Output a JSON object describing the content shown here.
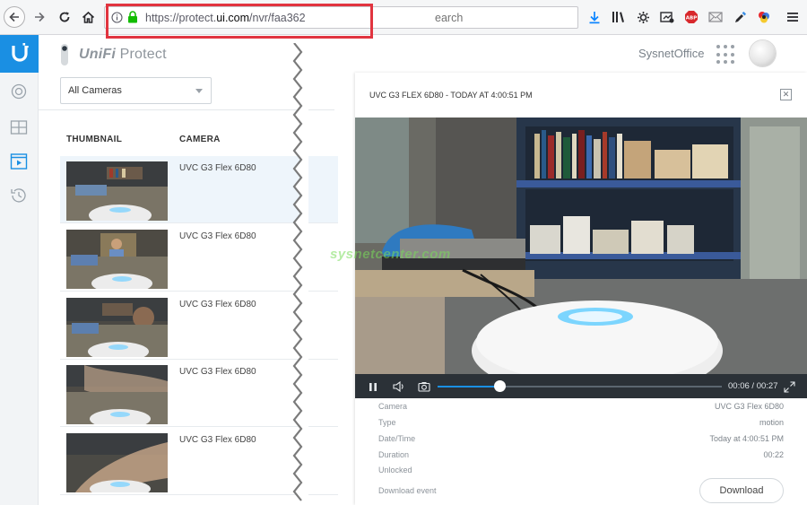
{
  "browser": {
    "url_prefix": "https://protect.",
    "url_host": "ui.com",
    "url_path": "/nvr/faa362",
    "search_fragment": "earch"
  },
  "header": {
    "brand_strong": "UniFi",
    "brand_light": "Protect",
    "site_name": "SysnetOffice"
  },
  "filter": {
    "selected": "All Cameras"
  },
  "table": {
    "columns": [
      "THUMBNAIL",
      "CAMERA"
    ],
    "rows": [
      {
        "camera": "UVC G3 Flex 6D80",
        "selected": true
      },
      {
        "camera": "UVC G3 Flex 6D80",
        "selected": false
      },
      {
        "camera": "UVC G3 Flex 6D80",
        "selected": false
      },
      {
        "camera": "UVC G3 Flex 6D80",
        "selected": false
      },
      {
        "camera": "UVC G3 Flex 6D80",
        "selected": false
      }
    ]
  },
  "panel": {
    "title": "UVC G3 FLEX 6D80 - TODAY AT 4:00:51 PM",
    "player": {
      "current": "00:06",
      "total": "00:27",
      "progress": 0.222
    },
    "details": [
      {
        "label": "Camera",
        "value": "UVC G3 Flex 6D80"
      },
      {
        "label": "Type",
        "value": "motion"
      },
      {
        "label": "Date/Time",
        "value": "Today at 4:00:51 PM"
      },
      {
        "label": "Duration",
        "value": "00:22"
      },
      {
        "label": "Unlocked",
        "value": ""
      }
    ],
    "download_label": "Download event",
    "download_button": "Download"
  },
  "watermark": "sysnetcenter.com",
  "colors": {
    "accent": "#1a8fe3",
    "highlight": "#e1343f",
    "player_bar": "#2b3137"
  }
}
